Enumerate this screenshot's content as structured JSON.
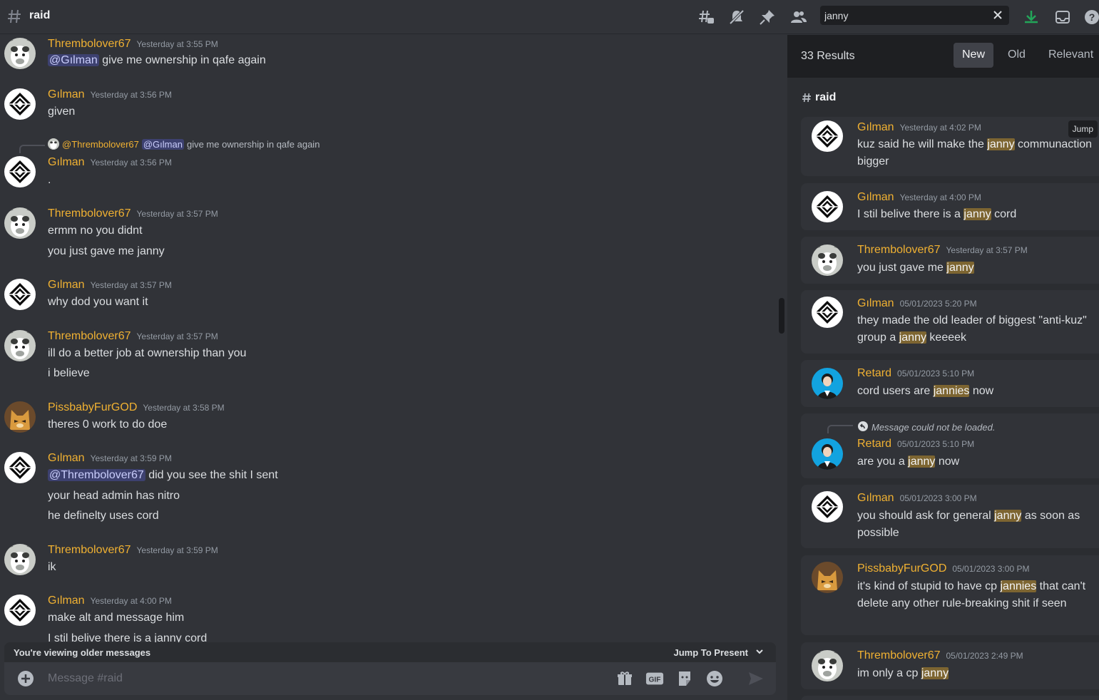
{
  "header": {
    "channel_name": "raid",
    "search_query": "janny"
  },
  "chat": {
    "messages": [
      {
        "author": "Thrembolover67",
        "time": "Yesterday at 3:55 PM",
        "avatar": "cow",
        "mention": "@Gılman",
        "lines": [
          "give me ownership in qafe again"
        ]
      },
      {
        "author": "Gılman",
        "time": "Yesterday at 3:56 PM",
        "avatar": "diamond",
        "lines": [
          "given"
        ]
      },
      {
        "reply_to_user": "@Thrembolover67",
        "reply_mention": "@Gılman",
        "reply_text": "give me ownership in qafe again",
        "author": "Gılman",
        "time": "Yesterday at 3:56 PM",
        "avatar": "diamond",
        "lines": [
          "."
        ]
      },
      {
        "author": "Thrembolover67",
        "time": "Yesterday at 3:57 PM",
        "avatar": "cow",
        "lines": [
          "ermm no you didnt",
          "you just gave me janny"
        ]
      },
      {
        "author": "Gılman",
        "time": "Yesterday at 3:57 PM",
        "avatar": "diamond",
        "lines": [
          "why dod you want it"
        ]
      },
      {
        "author": "Thrembolover67",
        "time": "Yesterday at 3:57 PM",
        "avatar": "cow",
        "lines": [
          "ill do a better job at ownership than you",
          "i believe"
        ]
      },
      {
        "author": "PissbabyFurGOD",
        "time": "Yesterday at 3:58 PM",
        "avatar": "fox",
        "lines": [
          "theres 0 work to do doe"
        ]
      },
      {
        "author": "Gılman",
        "time": "Yesterday at 3:59 PM",
        "avatar": "diamond",
        "mention": "@Thrembolover67",
        "lines": [
          "did you see the shit I sent",
          "your head admin has nitro",
          "he definelty uses cord"
        ]
      },
      {
        "author": "Thrembolover67",
        "time": "Yesterday at 3:59 PM",
        "avatar": "cow",
        "lines": [
          "ik"
        ]
      },
      {
        "author": "Gılman",
        "time": "Yesterday at 4:00 PM",
        "avatar": "diamond",
        "lines": [
          "make alt and message him",
          "I stil belive there is a janny cord"
        ]
      }
    ],
    "older_notice": "You're viewing older messages",
    "jump_to_present": "Jump To Present",
    "composer_placeholder": "Message #raid"
  },
  "search_panel": {
    "results_count": "33 Results",
    "sort_tabs": [
      "New",
      "Old",
      "Relevant"
    ],
    "active_tab": "New",
    "channel": "raid",
    "jump_label": "Jump",
    "reply_unavailable": "Message could not be loaded.",
    "results": [
      {
        "author": "Gılman",
        "time": "Yesterday at 4:02 PM",
        "avatar": "diamond",
        "segments": [
          [
            "kuz said he will make the ",
            false
          ],
          [
            "janny",
            true
          ],
          [
            " communaction bigger",
            false
          ]
        ]
      },
      {
        "author": "Gılman",
        "time": "Yesterday at 4:00 PM",
        "avatar": "diamond",
        "segments": [
          [
            "I stil belive there is a ",
            false
          ],
          [
            "janny",
            true
          ],
          [
            " cord",
            false
          ]
        ]
      },
      {
        "author": "Thrembolover67",
        "time": "Yesterday at 3:57 PM",
        "avatar": "cow",
        "segments": [
          [
            "you just gave me ",
            false
          ],
          [
            "janny",
            true
          ]
        ]
      },
      {
        "author": "Gılman",
        "time": "05/01/2023 5:20 PM",
        "avatar": "diamond",
        "segments": [
          [
            "they made the old leader of biggest \"anti-kuz\" group a ",
            false
          ],
          [
            "janny",
            true
          ],
          [
            " keeeek",
            false
          ]
        ]
      },
      {
        "author": "Retard",
        "time": "05/01/2023 5:10 PM",
        "avatar": "blue",
        "segments": [
          [
            "cord users are ",
            false
          ],
          [
            "jannies",
            true
          ],
          [
            " now",
            false
          ]
        ]
      },
      {
        "author": "Retard",
        "time": "05/01/2023 5:10 PM",
        "avatar": "blue",
        "has_reply": true,
        "segments": [
          [
            "are you a ",
            false
          ],
          [
            "janny",
            true
          ],
          [
            " now",
            false
          ]
        ]
      },
      {
        "author": "Gılman",
        "time": "05/01/2023 3:00 PM",
        "avatar": "diamond",
        "segments": [
          [
            "you should ask for general ",
            false
          ],
          [
            "janny",
            true
          ],
          [
            " as soon as possible",
            false
          ]
        ]
      },
      {
        "author": "PissbabyFurGOD",
        "time": "05/01/2023 3:00 PM",
        "avatar": "fox",
        "segments": [
          [
            "it's kind of stupid to have cp ",
            false
          ],
          [
            "jannies",
            true
          ],
          [
            " that can't delete any other rule-breaking shit if seen",
            false
          ]
        ]
      },
      {
        "author": "Thrembolover67",
        "time": "05/01/2023 2:49 PM",
        "avatar": "cow",
        "segments": [
          [
            "im only a cp ",
            false
          ],
          [
            "janny",
            true
          ]
        ]
      }
    ]
  },
  "colors": {
    "username": "#f0b132",
    "mention_bg": "#3c4270",
    "highlight": "#7d6531",
    "background": "#313338",
    "panel": "#2b2d31"
  },
  "icons": {
    "header": [
      "threads-icon",
      "mute-icon",
      "pin-icon",
      "members-icon",
      "inbox-download-icon",
      "inbox-icon",
      "help-icon"
    ],
    "composer": [
      "gift-icon",
      "gif-icon",
      "sticker-icon",
      "emoji-icon",
      "send-icon"
    ]
  }
}
